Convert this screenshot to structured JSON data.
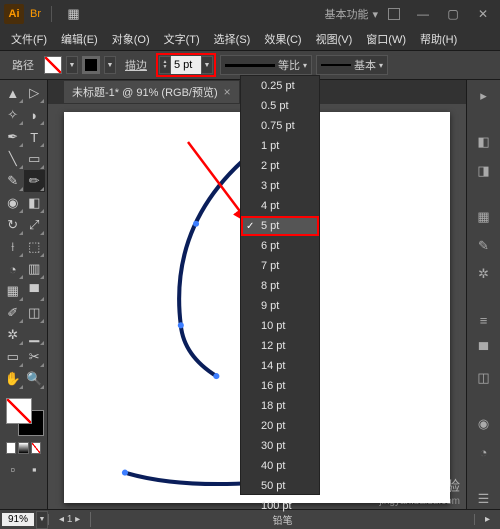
{
  "titlebar": {
    "logo_text": "Ai",
    "mode_label": "基本功能"
  },
  "menu": [
    "文件(F)",
    "编辑(E)",
    "对象(O)",
    "文字(T)",
    "选择(S)",
    "效果(C)",
    "视图(V)",
    "窗口(W)",
    "帮助(H)"
  ],
  "controlbar": {
    "selection_label": "路径",
    "stroke_label": "描边",
    "stroke_value": "5 pt",
    "profile_label": "等比",
    "brush_label": "基本"
  },
  "doc_tab": {
    "title": "未标题-1* @ 91% (RGB/预览)"
  },
  "stroke_options": [
    "0.25 pt",
    "0.5 pt",
    "0.75 pt",
    "1 pt",
    "2 pt",
    "3 pt",
    "4 pt",
    "5 pt",
    "6 pt",
    "7 pt",
    "8 pt",
    "9 pt",
    "10 pt",
    "12 pt",
    "14 pt",
    "16 pt",
    "18 pt",
    "20 pt",
    "30 pt",
    "40 pt",
    "50 pt",
    "100 pt"
  ],
  "stroke_selected_index": 7,
  "statusbar": {
    "zoom": "91%",
    "tool": "铅笔"
  },
  "watermark": {
    "main": "Baidu 经验",
    "sub": "jingyan.baidu.com"
  }
}
